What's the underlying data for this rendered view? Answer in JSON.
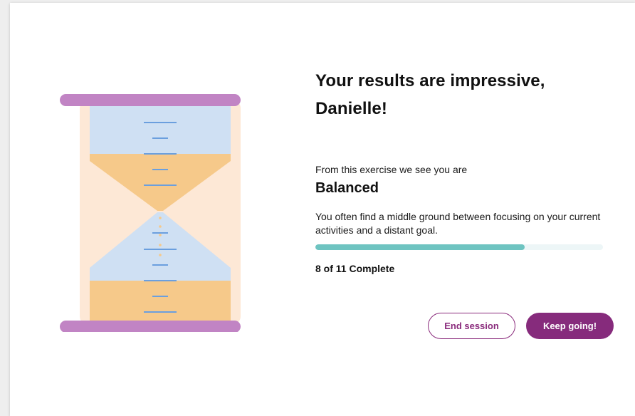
{
  "result": {
    "headline": "Your results are impressive, Danielle!",
    "intro": "From this exercise we see you are",
    "type": "Balanced",
    "description": "You often find a middle ground between focusing on your current activities and a distant goal."
  },
  "progress": {
    "completed": 8,
    "total": 11,
    "fraction": 0.7273,
    "label": "8 of 11 Complete"
  },
  "actions": {
    "end_label": "End session",
    "keep_label": "Keep going!"
  },
  "illustration": {
    "icon": "hourglass-icon"
  },
  "colors": {
    "accent": "#862b7c",
    "progress_fill": "#6ec4c1",
    "progress_track": "#edf6f7",
    "hourglass_frame": "#c184c4",
    "hourglass_glass": "#fde8d6",
    "sand": "#f6c98a",
    "water": "#cfe0f3",
    "tick": "#6b9fde"
  }
}
